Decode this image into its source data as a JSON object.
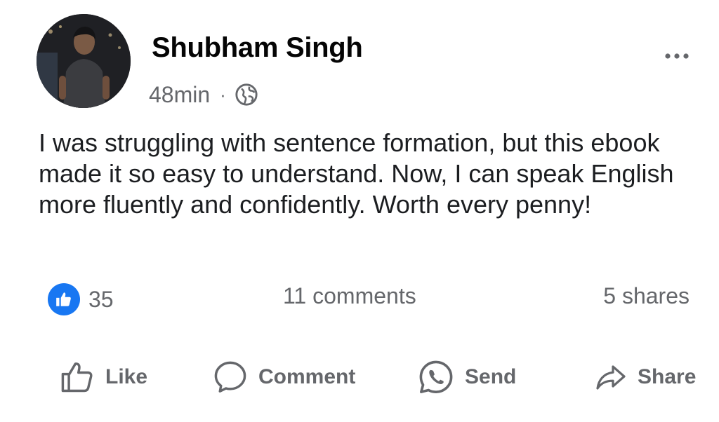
{
  "post": {
    "author": "Shubham Singh",
    "timestamp": "48min",
    "separator": "·",
    "privacy_icon": "globe-icon",
    "more_icon": "more-horizontal-icon",
    "text": "I was struggling with sentence formation, but this ebook made it so easy to understand. Now, I can speak English more fluently and confidently. Worth every penny!"
  },
  "stats": {
    "reaction_icon": "thumbs-up-icon",
    "reactions_count": "35",
    "comments": "11 comments",
    "shares": "5 shares"
  },
  "actions": {
    "like": "Like",
    "comment": "Comment",
    "send": "Send",
    "share": "Share"
  },
  "colors": {
    "accent": "#1877f2",
    "secondary_text": "#65676b",
    "primary_text": "#050505"
  }
}
